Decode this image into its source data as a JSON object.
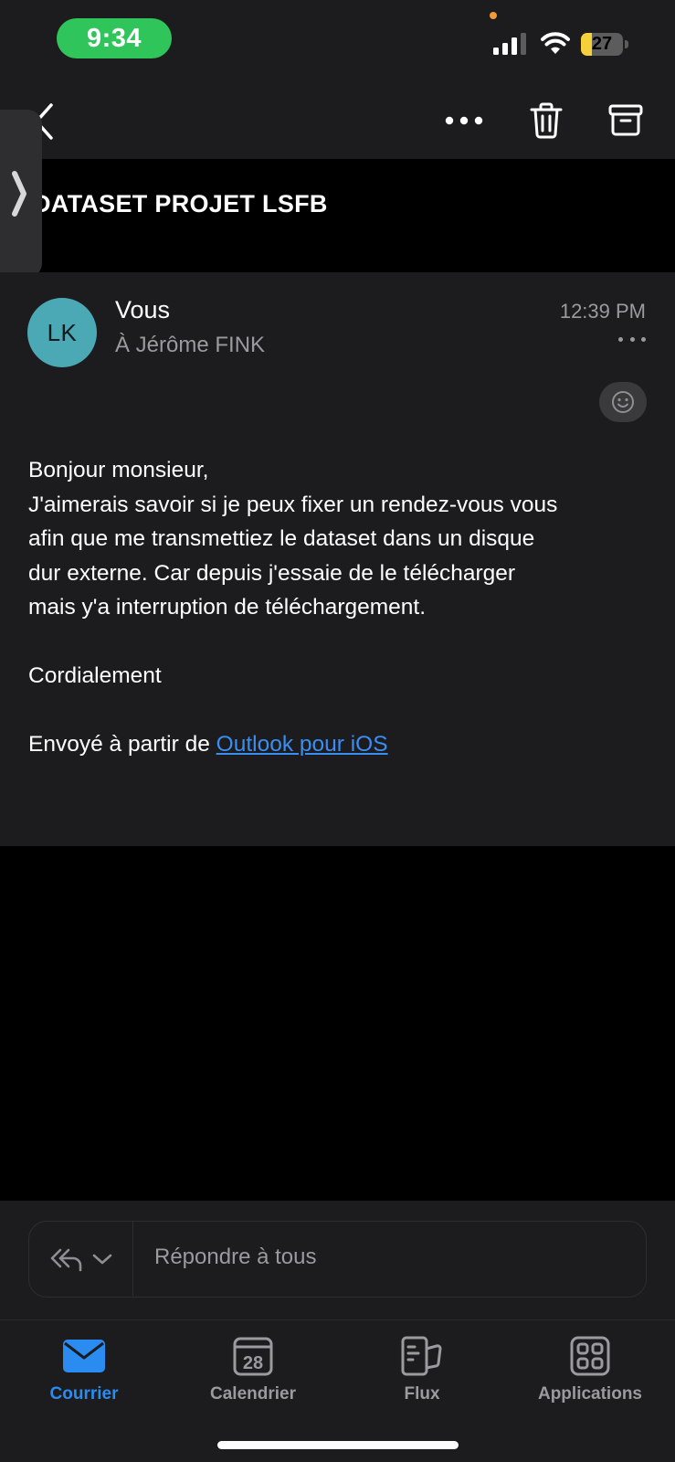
{
  "status_bar": {
    "time": "9:34",
    "battery_level": "27",
    "battery_fraction": 0.27,
    "icons": [
      "signal-icon",
      "wifi-icon",
      "battery-icon"
    ]
  },
  "toolbar": {
    "icons": [
      "back-chevron-icon",
      "more-icon",
      "trash-icon",
      "archive-icon"
    ]
  },
  "subject": "DATASET PROJET LSFB",
  "message": {
    "avatar_initials": "LK",
    "sender": "Vous",
    "recipient": "À Jérôme FINK",
    "time": "12:39 PM",
    "body_lines": [
      "Bonjour monsieur,",
      "J'aimerais savoir si je peux fixer un rendez-vous vous",
      "afin que me transmettiez le dataset dans un disque",
      "dur externe. Car depuis j'essaie de le télécharger",
      "mais y'a interruption de téléchargement."
    ],
    "closing": "Cordialement",
    "signature_prefix": "Envoyé à partir de ",
    "signature_link": "Outlook pour iOS"
  },
  "reply": {
    "label": "Répondre à tous"
  },
  "tabs": [
    {
      "label": "Courrier",
      "icon": "mail-icon",
      "active": true
    },
    {
      "label": "Calendrier",
      "icon": "calendar-icon",
      "active": false,
      "day": "28"
    },
    {
      "label": "Flux",
      "icon": "feed-icon",
      "active": false
    },
    {
      "label": "Applications",
      "icon": "apps-icon",
      "active": false
    }
  ],
  "colors": {
    "accent": "#2a8bf0",
    "avatar": "#4ba8b5",
    "time_pill": "#30c55a",
    "battery_fill": "#f5d03a"
  }
}
